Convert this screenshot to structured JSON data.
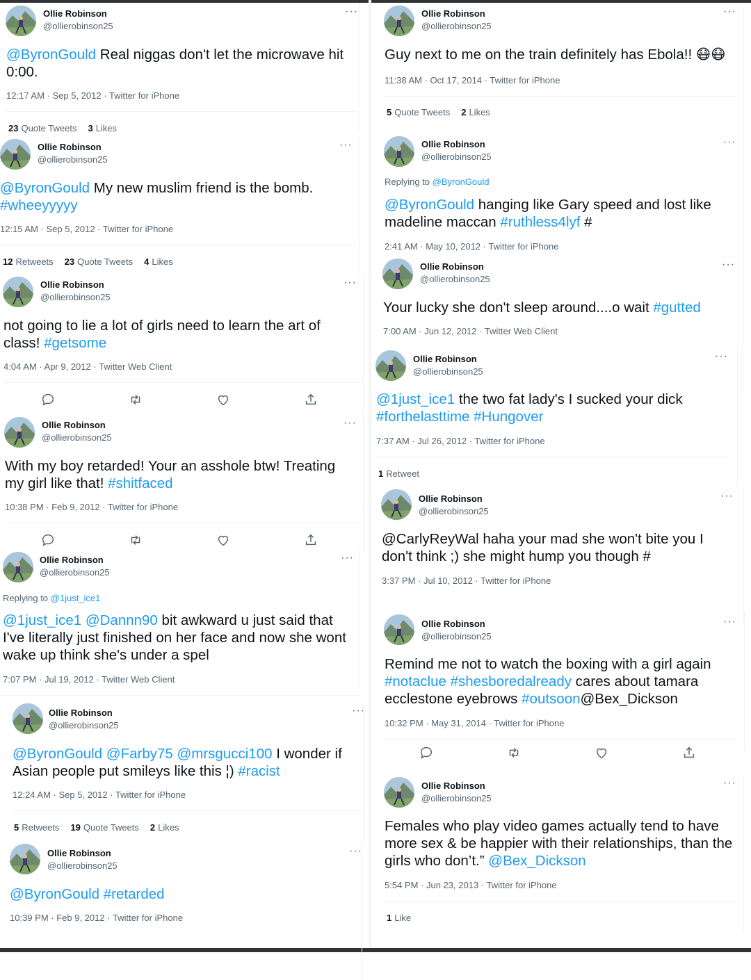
{
  "tweets": [
    {
      "name": "Ollie Robinson",
      "handle": "@ollierobinson25",
      "reply": null,
      "text": [
        {
          "t": "@ByronGould",
          "link": true
        },
        {
          "t": "  Real niggas don't let the microwave hit 0:00.",
          "link": false
        }
      ],
      "meta": "12:17 AM · Sep 5, 2012 · Twitter for iPhone",
      "stats": [
        {
          "n": "23",
          "l": "Quote Tweets"
        },
        {
          "n": "3",
          "l": "Likes"
        }
      ]
    },
    {
      "name": "Ollie Robinson",
      "handle": "@ollierobinson25",
      "reply": null,
      "text": [
        {
          "t": "@ByronGould",
          "link": true
        },
        {
          "t": "  My new muslim friend is the bomb. ",
          "link": false
        },
        {
          "t": "#wheeyyyyy",
          "link": true
        }
      ],
      "meta": "12:15 AM · Sep 5, 2012 · Twitter for iPhone",
      "stats": [
        {
          "n": "12",
          "l": "Retweets"
        },
        {
          "n": "23",
          "l": "Quote Tweets"
        },
        {
          "n": "4",
          "l": "Likes"
        }
      ]
    },
    {
      "name": "Ollie Robinson",
      "handle": "@ollierobinson25",
      "reply": null,
      "text": [
        {
          "t": "not going to lie a lot of girls need to learn the art of class! ",
          "link": false
        },
        {
          "t": "#getsome",
          "link": true
        }
      ],
      "meta": "4:04 AM · Apr 9, 2012 · Twitter Web Client",
      "stats": []
    },
    {
      "name": "Ollie Robinson",
      "handle": "@ollierobinson25",
      "reply": null,
      "text": [
        {
          "t": "With my boy retarded! Your an asshole btw! Treating my girl like that! ",
          "link": false
        },
        {
          "t": "#shitfaced",
          "link": true
        }
      ],
      "meta": "10:38 PM · Feb 9, 2012 · Twitter for iPhone",
      "stats": []
    },
    {
      "name": "Ollie Robinson",
      "handle": "@ollierobinson25",
      "reply": {
        "prefix": "Replying to ",
        "to": "@1just_ice1"
      },
      "text": [
        {
          "t": "@1just_ice1 @Dannn90",
          "link": true
        },
        {
          "t": " bit awkward u just said that I've literally just finished on her face and now she wont wake up think she's under a spel",
          "link": false
        }
      ],
      "meta": "7:07 PM · Jul 19, 2012 · Twitter Web Client",
      "stats": []
    },
    {
      "name": "Ollie Robinson",
      "handle": "@ollierobinson25",
      "reply": null,
      "text": [
        {
          "t": "@ByronGould @Farby75 @mrsgucci100",
          "link": true
        },
        {
          "t": "   I wonder if Asian people put smileys like this ¦) ",
          "link": false
        },
        {
          "t": "#racist",
          "link": true
        }
      ],
      "meta": "12:24 AM · Sep 5, 2012 · Twitter for iPhone",
      "stats": [
        {
          "n": "5",
          "l": "Retweets"
        },
        {
          "n": "19",
          "l": "Quote Tweets"
        },
        {
          "n": "2",
          "l": "Likes"
        }
      ]
    },
    {
      "name": "Ollie Robinson",
      "handle": "@ollierobinson25",
      "reply": null,
      "text": [
        {
          "t": "@ByronGould #retarded",
          "link": true
        }
      ],
      "meta": "10:39 PM · Feb 9, 2012 · Twitter for iPhone",
      "stats": []
    },
    {
      "name": "Ollie Robinson",
      "handle": "@ollierobinson25",
      "reply": null,
      "text": [
        {
          "t": "Guy next to me on the train definitely has Ebola!! 😷😷",
          "link": false
        }
      ],
      "meta": "11:38 AM · Oct 17, 2014 · Twitter for iPhone",
      "stats": [
        {
          "n": "5",
          "l": "Quote Tweets"
        },
        {
          "n": "2",
          "l": "Likes"
        }
      ]
    },
    {
      "name": "Ollie Robinson",
      "handle": "@ollierobinson25",
      "reply": {
        "prefix": "Replying to ",
        "to": "@ByronGould"
      },
      "text": [
        {
          "t": "@ByronGould",
          "link": true
        },
        {
          "t": " hanging like Gary speed and lost like madeline maccan ",
          "link": false
        },
        {
          "t": "#ruthless4lyf",
          "link": true
        },
        {
          "t": " #",
          "link": false
        }
      ],
      "meta": "2:41 AM · May 10, 2012 · Twitter for iPhone",
      "stats": []
    },
    {
      "name": "Ollie Robinson",
      "handle": "@ollierobinson25",
      "reply": null,
      "text": [
        {
          "t": "Your lucky she don't sleep around....o wait ",
          "link": false
        },
        {
          "t": "#gutted",
          "link": true
        }
      ],
      "meta": "7:00 AM · Jun 12, 2012 · Twitter Web Client",
      "stats": []
    },
    {
      "name": "Ollie Robinson",
      "handle": "@ollierobinson25",
      "reply": null,
      "text": [
        {
          "t": "@1just_ice1",
          "link": true
        },
        {
          "t": " the two fat lady's I sucked your dick ",
          "link": false
        },
        {
          "t": "#forthelasttime #Hungover",
          "link": true
        }
      ],
      "meta": "7:37 AM · Jul 26, 2012 · Twitter for iPhone",
      "stats": [
        {
          "n": "1",
          "l": "Retweet"
        }
      ]
    },
    {
      "name": "Ollie Robinson",
      "handle": "@ollierobinson25",
      "reply": null,
      "text": [
        {
          "t": "@CarlyReyWal haha your mad she won't bite you I don't think ;) she might hump you though #",
          "link": false
        }
      ],
      "meta": "3:37 PM · Jul 10, 2012 · Twitter for iPhone",
      "stats": []
    },
    {
      "name": "Ollie Robinson",
      "handle": "@ollierobinson25",
      "reply": null,
      "text": [
        {
          "t": "Remind me not to watch the boxing with a girl again ",
          "link": false
        },
        {
          "t": "#notaclue #shesboredalready",
          "link": true
        },
        {
          "t": " cares about tamara ecclestone eyebrows ",
          "link": false
        },
        {
          "t": "#outsoon",
          "link": true
        },
        {
          "t": "@Bex_Dickson",
          "link": false
        }
      ],
      "meta": "10:32 PM · May 31, 2014 · Twitter for iPhone",
      "stats": []
    },
    {
      "name": "Ollie Robinson",
      "handle": "@ollierobinson25",
      "reply": null,
      "text": [
        {
          "t": "Females who play video games actually tend to have more sex & be happier with their relationships, than the girls who don’t.” ",
          "link": false
        },
        {
          "t": "@Bex_Dickson",
          "link": true
        }
      ],
      "meta": "5:54 PM · Jun 23, 2013 · Twitter for iPhone",
      "stats": [
        {
          "n": "1",
          "l": "Like"
        }
      ]
    }
  ],
  "icons": {
    "more": "more-icon",
    "reply": "reply-icon",
    "retweet": "retweet-icon",
    "like": "like-icon",
    "share": "share-icon"
  },
  "colors": {
    "link": "#1d9bf0",
    "muted": "#536471",
    "text": "#0f1419"
  }
}
